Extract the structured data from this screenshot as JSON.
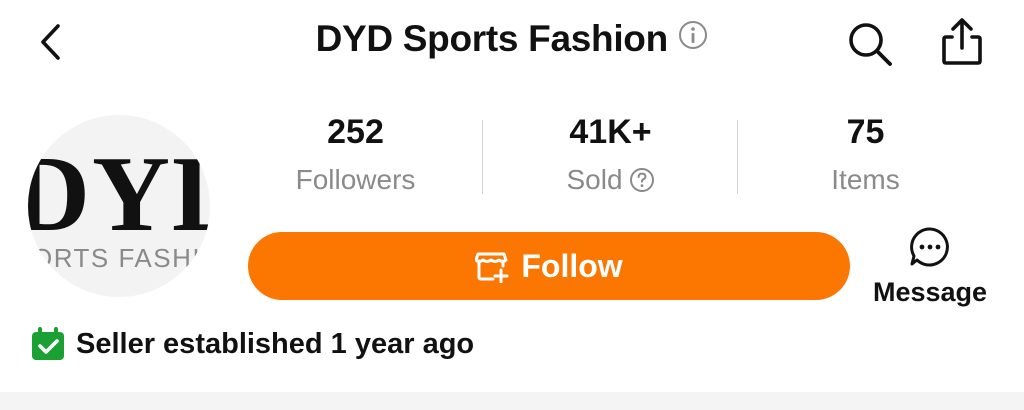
{
  "header": {
    "back_icon": "chevron-left-icon",
    "title": "DYD Sports Fashion",
    "info_icon": "info-icon",
    "search_icon": "search-icon",
    "share_icon": "share-icon"
  },
  "store": {
    "logo_text": "DYL",
    "logo_subtext": "ORTS FASHI"
  },
  "stats": [
    {
      "value": "252",
      "label": "Followers"
    },
    {
      "value": "41K+",
      "label": "Sold"
    },
    {
      "value": "75",
      "label": "Items"
    }
  ],
  "actions": {
    "follow_label": "Follow",
    "message_label": "Message"
  },
  "seller_info": {
    "text": "Seller established 1 year ago"
  },
  "colors": {
    "accent": "#fb7701",
    "verified_green": "#1aa033"
  }
}
